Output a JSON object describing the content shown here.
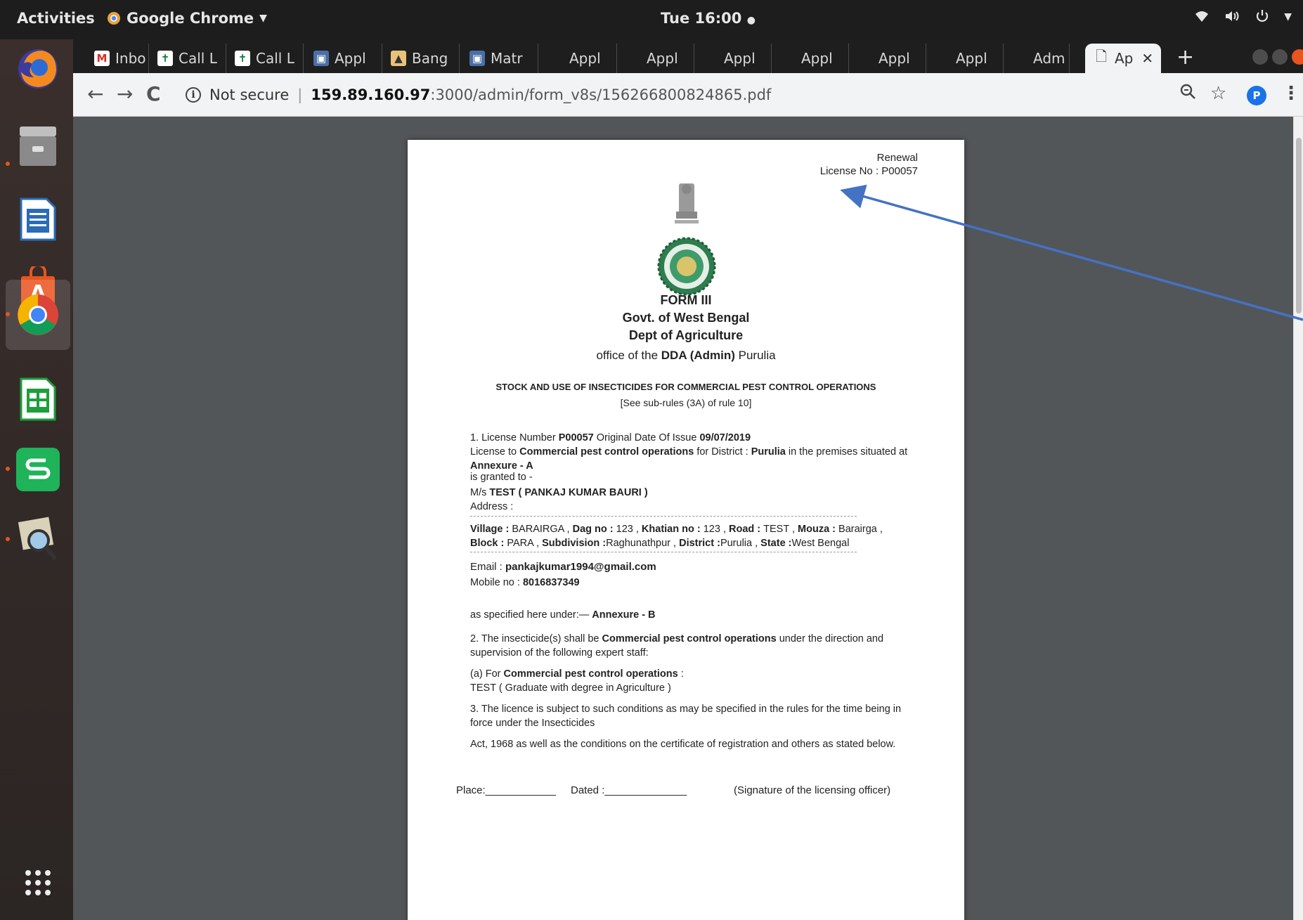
{
  "topbar": {
    "activities": "Activities",
    "app_name": "Google Chrome",
    "clock": "Tue 16:00"
  },
  "dock": {
    "items": [
      "firefox-icon",
      "files-icon",
      "writer-icon",
      "software-center-icon",
      "chrome-icon",
      "calc-icon",
      "wps-spreadsheet-icon",
      "image-viewer-icon",
      "app-grid-icon"
    ]
  },
  "tabs": [
    {
      "label": "Inbo",
      "icon": "gmail-icon"
    },
    {
      "label": "Call L",
      "icon": "cross-icon"
    },
    {
      "label": "Call L",
      "icon": "cross-icon"
    },
    {
      "label": "Appl",
      "icon": "app-icon"
    },
    {
      "label": "Bang",
      "icon": "app-icon"
    },
    {
      "label": "Matr",
      "icon": "app-icon"
    },
    {
      "label": "Appl",
      "icon": "blank"
    },
    {
      "label": "Appl",
      "icon": "blank"
    },
    {
      "label": "Appl",
      "icon": "blank"
    },
    {
      "label": "Appl",
      "icon": "blank"
    },
    {
      "label": "Appl",
      "icon": "blank"
    },
    {
      "label": "Appl",
      "icon": "blank"
    },
    {
      "label": "Adm",
      "icon": "blank"
    },
    {
      "label": "Ap",
      "icon": "document-icon",
      "active": true
    }
  ],
  "omnibox": {
    "security": "Not secure",
    "host": "159.89.160.97",
    "path": ":3000/admin/form_v8s/156266800824865.pdf"
  },
  "profile_initial": "P",
  "pdf": {
    "renewal": "Renewal",
    "license_no_line": "License No : P00057",
    "form_title": "FORM III",
    "govt": "Govt. of West Bengal",
    "dept": "Dept of Agriculture",
    "office_prefix": "office of the ",
    "office_bold": "DDA (Admin)",
    "office_suffix": " Purulia",
    "subject": "STOCK AND USE OF INSECTICIDES FOR COMMERCIAL PEST CONTROL OPERATIONS",
    "subrule": "[See sub-rules (3A) of rule 10]",
    "p1_a": "1. License Number ",
    "p1_license": "P00057",
    "p1_b": " Original Date Of Issue ",
    "p1_date": "09/07/2019",
    "p1_c": "License to ",
    "p1_purpose": "Commercial pest control operations",
    "p1_d": " for District : ",
    "p1_district": "Purulia",
    "p1_e": " in the premises situated at ",
    "p1_annex": "Annexure - A",
    "granted": "is granted to -",
    "ms_prefix": "M/s ",
    "ms_name": "TEST ( PANKAJ KUMAR BAURI )",
    "address_label": "Address :",
    "addr": {
      "village_l": "Village : ",
      "village": "BARAIRGA , ",
      "dag_l": "Dag no : ",
      "dag": "123 , ",
      "khatian_l": "Khatian no : ",
      "khatian": "123 , ",
      "road_l": "Road : ",
      "road": "TEST , ",
      "mouza_l": "Mouza : ",
      "mouza": "Barairga ,",
      "block_l": "Block : ",
      "block": "PARA , ",
      "subdiv_l": "Subdivision :",
      "subdiv": "Raghunathpur , ",
      "district_l": "District :",
      "district": "Purulia , ",
      "state_l": "State :",
      "state": "West Bengal"
    },
    "email_label": "Email : ",
    "email": "pankajkumar1994@gmail.com",
    "mobile_label": "Mobile no : ",
    "mobile": "8016837349",
    "specified_a": "as specified here under:— ",
    "specified_b": "Annexure - B",
    "p2_a": "2. The insecticide(s) shall be ",
    "p2_b": "Commercial pest control operations",
    "p2_c": " under the direction and supervision of the following expert staff:",
    "pa_a": "(a) For ",
    "pa_b": "Commercial pest control operations",
    "pa_c": " :",
    "pa_staff": "TEST ( Graduate with degree in Agriculture )",
    "p3": "3. The licence is subject to such conditions as may be specified in the rules for the time being in force under the Insecticides",
    "p4": "Act, 1968 as well as the conditions on the certificate of registration and others as stated below.",
    "place": "Place:____________",
    "dated": "Dated :______________",
    "signature": "(Signature of the licensing officer)"
  },
  "colors": {
    "arrow": "#4472c4",
    "ubuntu_orange": "#e95420",
    "pdf_bg": "#525659"
  }
}
